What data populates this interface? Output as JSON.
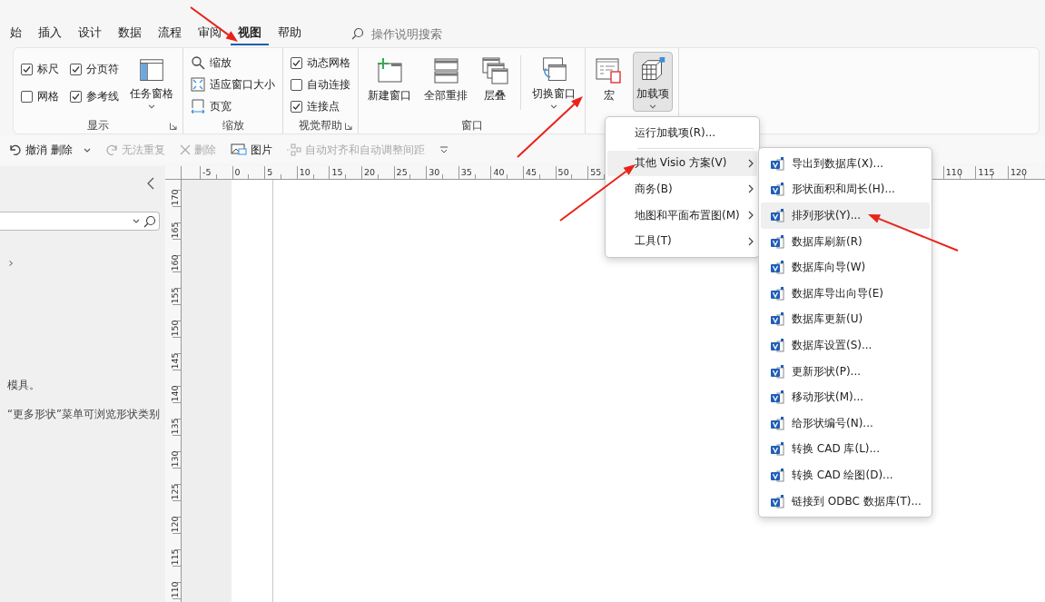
{
  "tabs": [
    {
      "label": "始",
      "selected": false
    },
    {
      "label": "插入",
      "selected": false
    },
    {
      "label": "设计",
      "selected": false
    },
    {
      "label": "数据",
      "selected": false
    },
    {
      "label": "流程",
      "selected": false
    },
    {
      "label": "审阅",
      "selected": false
    },
    {
      "label": "视图",
      "selected": true
    },
    {
      "label": "帮助",
      "selected": false
    }
  ],
  "tell_me": {
    "placeholder": "操作说明搜索"
  },
  "ribbon": {
    "groups": [
      {
        "label": "显示",
        "launcher": true,
        "items": [
          {
            "kind": "check",
            "label": "标尺",
            "checked": true
          },
          {
            "kind": "check",
            "label": "网格",
            "checked": false
          },
          {
            "kind": "check",
            "label": "分页符",
            "checked": true
          },
          {
            "kind": "check",
            "label": "参考线",
            "checked": true
          },
          {
            "kind": "large",
            "label": "任务窗格",
            "dropdown": true,
            "expanded": false
          }
        ]
      },
      {
        "label": "缩放",
        "launcher": false,
        "items": [
          {
            "kind": "small",
            "label": "缩放"
          },
          {
            "kind": "small",
            "label": "适应窗口大小"
          },
          {
            "kind": "small",
            "label": "页宽"
          }
        ]
      },
      {
        "label": "视觉帮助",
        "launcher": true,
        "items": [
          {
            "kind": "check",
            "label": "动态网格",
            "checked": true
          },
          {
            "kind": "check",
            "label": "自动连接",
            "checked": false
          },
          {
            "kind": "check",
            "label": "连接点",
            "checked": true
          }
        ]
      },
      {
        "label": "窗口",
        "launcher": false,
        "items": [
          {
            "kind": "large",
            "label": "新建窗口",
            "dropdown": false,
            "expanded": false
          },
          {
            "kind": "large",
            "label": "全部重排",
            "dropdown": false,
            "expanded": false
          },
          {
            "kind": "large",
            "label": "层叠",
            "dropdown": false,
            "expanded": false
          },
          {
            "kind": "large",
            "label": "切换窗口",
            "dropdown": true,
            "expanded": false
          }
        ]
      },
      {
        "launcher": false,
        "items": [
          {
            "kind": "large",
            "label": "宏",
            "dropdown": false,
            "expanded": false
          },
          {
            "kind": "large",
            "label": "加载项",
            "dropdown": true,
            "expanded": true
          }
        ]
      }
    ]
  },
  "quick_access": [
    {
      "label": "撤消 删除",
      "disabled": false,
      "dropdown": true
    },
    {
      "label": "无法重复",
      "disabled": true,
      "dropdown": false
    },
    {
      "label": "删除",
      "disabled": true,
      "dropdown": false
    },
    {
      "label": "图片",
      "disabled": false,
      "dropdown": false
    },
    {
      "label": "自动对齐和自动调整间距",
      "disabled": true,
      "dropdown": false
    }
  ],
  "shapes_panel": {
    "hint_lines": [
      "模具。",
      "“更多形状”菜单可浏览形状类别"
    ]
  },
  "horizontal_ruler": {
    "labels": [
      "-5",
      "0",
      "5",
      "10",
      "15",
      "20",
      "25",
      "30",
      "35",
      "40",
      "45",
      "50",
      "55"
    ],
    "labels_far": [
      "110",
      "115",
      "120"
    ]
  },
  "vertical_ruler": {
    "labels": [
      "170",
      "165",
      "160",
      "155",
      "150",
      "145",
      "140",
      "135",
      "130",
      "125",
      "120",
      "115",
      "110"
    ]
  },
  "addins_menu": {
    "items": [
      {
        "label": "运行加载项(R)...",
        "submenu": false,
        "selected": false
      },
      {
        "label": "其他 Visio 方案(V)",
        "submenu": true,
        "selected": true
      },
      {
        "label": "商务(B)",
        "submenu": true,
        "selected": false
      },
      {
        "label": "地图和平面布置图(M)",
        "submenu": true,
        "selected": false
      },
      {
        "label": "工具(T)",
        "submenu": true,
        "selected": false
      }
    ]
  },
  "solutions_submenu": {
    "items": [
      {
        "label": "导出到数据库(X)...",
        "selected": false
      },
      {
        "label": "形状面积和周长(H)...",
        "selected": false
      },
      {
        "label": "排列形状(Y)...",
        "selected": true
      },
      {
        "label": "数据库刷新(R)",
        "selected": false
      },
      {
        "label": "数据库向导(W)",
        "selected": false
      },
      {
        "label": "数据库导出向导(E)",
        "selected": false
      },
      {
        "label": "数据库更新(U)",
        "selected": false
      },
      {
        "label": "数据库设置(S)...",
        "selected": false
      },
      {
        "label": "更新形状(P)...",
        "selected": false
      },
      {
        "label": "移动形状(M)...",
        "selected": false
      },
      {
        "label": "给形状编号(N)...",
        "selected": false
      },
      {
        "label": "转换 CAD 库(L)...",
        "selected": false
      },
      {
        "label": "转换 CAD 绘图(D)...",
        "selected": false
      },
      {
        "label": "链接到 ODBC 数据库(T)...",
        "selected": false
      }
    ]
  }
}
